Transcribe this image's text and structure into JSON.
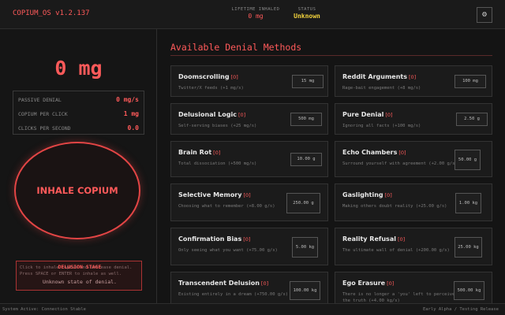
{
  "header": {
    "app_title": "COPIUM_OS v1.2.137",
    "lifetime_label": "LIFETIME INHALED",
    "lifetime_value": "0 mg",
    "status_label": "STATUS",
    "status_value": "Unknown",
    "settings_icon": "gear-icon",
    "settings_glyph": "⚙"
  },
  "sidebar": {
    "total_copium": "0 mg",
    "stats": [
      {
        "label": "PASSIVE DENIAL",
        "value": "0 mg/s"
      },
      {
        "label": "COPIUM PER CLICK",
        "value": "1 mg"
      },
      {
        "label": "CLICKS PER SECOND",
        "value": "0.0"
      }
    ],
    "inhale_label": "INHALE COPIUM",
    "stage": {
      "hint": "Click to inhale copium and increase denial. Press SPACE or ENTER to inhale as well.",
      "title": "DELUSION STAGE",
      "description": "Unknown state of denial."
    }
  },
  "main": {
    "section_title": "Available Denial Methods",
    "methods": [
      {
        "name": "Doomscrolling",
        "count": "[0]",
        "desc": "Twitter/X feeds (+1 mg/s)",
        "price": "15 mg"
      },
      {
        "name": "Reddit Arguments",
        "count": "[0]",
        "desc": "Rage-bait engagement (+8 mg/s)",
        "price": "100 mg"
      },
      {
        "name": "Delusional Logic",
        "count": "[0]",
        "desc": "Self-serving biases (+25 mg/s)",
        "price": "500 mg"
      },
      {
        "name": "Pure Denial",
        "count": "[0]",
        "desc": "Ignoring all facts (+100 mg/s)",
        "price": "2.50 g"
      },
      {
        "name": "Brain Rot",
        "count": "[0]",
        "desc": "Total dissociation (+500 mg/s)",
        "price": "10.00 g"
      },
      {
        "name": "Echo Chambers",
        "count": "[0]",
        "desc": "Surround yourself with agreement (+2.00 g/s)",
        "price": "50.00 g"
      },
      {
        "name": "Selective Memory",
        "count": "[0]",
        "desc": "Choosing what to remember (+8.00 g/s)",
        "price": "250.00 g"
      },
      {
        "name": "Gaslighting",
        "count": "[0]",
        "desc": "Making others doubt reality (+25.00 g/s)",
        "price": "1.00 kg"
      },
      {
        "name": "Confirmation Bias",
        "count": "[0]",
        "desc": "Only seeing what you want (+75.00 g/s)",
        "price": "5.00 kg"
      },
      {
        "name": "Reality Refusal",
        "count": "[0]",
        "desc": "The ultimate wall of denial (+200.00 g/s)",
        "price": "25.00 kg"
      },
      {
        "name": "Transcendent Delusion",
        "count": "[0]",
        "desc": "Existing entirely in a dream (+750.00 g/s)",
        "price": "100.00 kg"
      },
      {
        "name": "Ego Erasure",
        "count": "[0]",
        "desc": "There is no longer a 'you' left to perceive the truth (+4.00 kg/s)",
        "price": "500.00 kg"
      }
    ]
  },
  "footer": {
    "left": "System Active: Connection Stable",
    "right": "Early Alpha / Testing Release"
  }
}
